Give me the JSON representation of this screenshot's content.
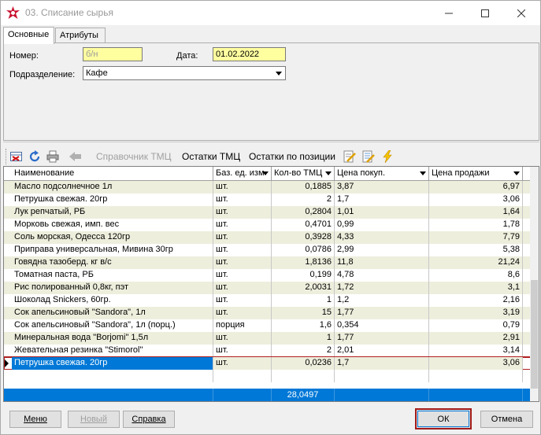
{
  "window": {
    "title": "03. Списание сырья",
    "accent": "#0078d7",
    "highlight_border": "#b01e1e"
  },
  "tabs": [
    {
      "label": "Основные",
      "active": true
    },
    {
      "label": "Атрибуты",
      "active": false
    }
  ],
  "form": {
    "number_label": "Номер:",
    "number_value": "б/н",
    "date_label": "Дата:",
    "date_value": "01.02.2022",
    "dept_label": "Подразделение:",
    "dept_value": "Кафе"
  },
  "toolbar": {
    "catalog_label": "Справочник ТМЦ",
    "stock_label": "Остатки ТМЦ",
    "stock_by_pos_label": "Остатки по позиции"
  },
  "grid": {
    "columns": [
      "Наименование",
      "Баз. ед. изм",
      "Кол-во ТМЦ",
      "Цена покуп.",
      "Цена продажи"
    ],
    "rows": [
      [
        "Масло подсолнечное 1л",
        "шт.",
        "0,1885",
        "3,87",
        "6,97"
      ],
      [
        "Петрушка свежая. 20гр",
        "шт.",
        "2",
        "1,7",
        "3,06"
      ],
      [
        "Лук репчатый, РБ",
        "шт.",
        "0,2804",
        "1,01",
        "1,64"
      ],
      [
        "Морковь свежая, имп. вес",
        "шт.",
        "0,4701",
        "0,99",
        "1,78"
      ],
      [
        "Соль морская, Одесса 120гр",
        "шт.",
        "0,3928",
        "4,33",
        "7,79"
      ],
      [
        "Приправа универсальная, Мивина 30гр",
        "шт.",
        "0,0786",
        "2,99",
        "5,38"
      ],
      [
        "Говядна тазоберд. кг в/с",
        "шт.",
        "1,8136",
        "11,8",
        "21,24"
      ],
      [
        "Томатная паста, РБ",
        "шт.",
        "0,199",
        "4,78",
        "8,6"
      ],
      [
        "Рис полированный 0,8кг, пэт",
        "шт.",
        "2,0031",
        "1,72",
        "3,1"
      ],
      [
        "Шоколад Snickers, 60гр.",
        "шт.",
        "1",
        "1,2",
        "2,16"
      ],
      [
        "Сок апельсиновый \"Sandora\", 1л",
        "шт.",
        "15",
        "1,77",
        "3,19"
      ],
      [
        "Сок апельсиновый \"Sandora\", 1л (порц.)",
        "порция",
        "1,6",
        "0,354",
        "0,79"
      ],
      [
        "Минеральная вода \"Borjomi\" 1,5л",
        "шт.",
        "1",
        "1,77",
        "2,91"
      ],
      [
        "Жевательная резинка \"Stimorol\"",
        "шт.",
        "2",
        "2,01",
        "3,14"
      ],
      [
        "Петрушка свежая. 20гр",
        "шт.",
        "0,0236",
        "1,7",
        "3,06"
      ]
    ],
    "selected_row": 14,
    "total_qty": "28,0497"
  },
  "buttons": {
    "menu": "Меню",
    "new": "Новый",
    "help": "Справка",
    "ok": "ОК",
    "cancel": "Отмена"
  }
}
